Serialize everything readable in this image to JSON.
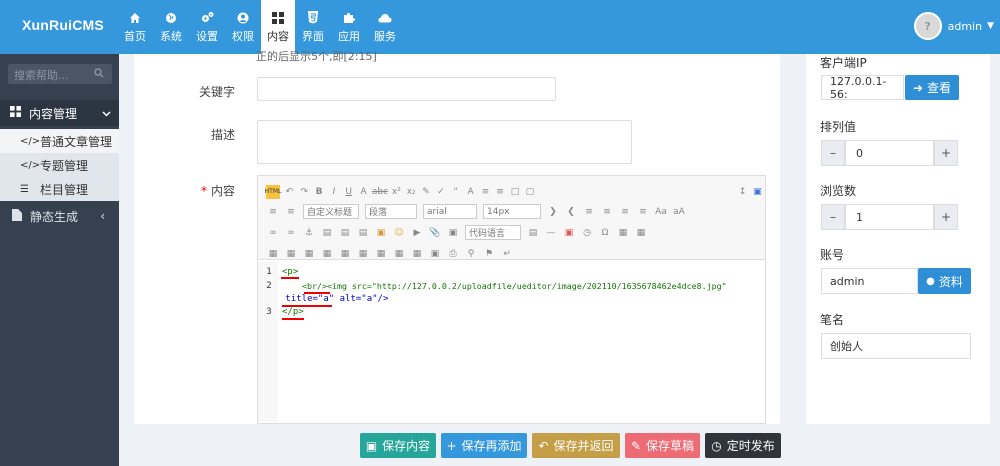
{
  "brand": {
    "logo": "XunRuiCMS"
  },
  "nav": [
    {
      "label": "首页",
      "icon": "home-icon"
    },
    {
      "label": "系统",
      "icon": "globe-icon"
    },
    {
      "label": "设置",
      "icon": "cogs-icon"
    },
    {
      "label": "权限",
      "icon": "user-circle-icon"
    },
    {
      "label": "内容",
      "icon": "grid-icon",
      "active": true
    },
    {
      "label": "界面",
      "icon": "html5-icon"
    },
    {
      "label": "应用",
      "icon": "puzzle-icon"
    },
    {
      "label": "服务",
      "icon": "cloud-icon"
    }
  ],
  "user": {
    "name": "admin"
  },
  "sidebar": {
    "search_placeholder": "搜索帮助...",
    "section": "内容管理",
    "items": [
      {
        "label": "普通文章管理",
        "icon": "code-icon"
      },
      {
        "label": "专题管理",
        "icon": "code-icon"
      },
      {
        "label": "栏目管理",
        "icon": "list-icon"
      }
    ],
    "section2": "静态生成"
  },
  "form": {
    "cut_text": "正的后显示5个,即[2:15]",
    "keywords_label": "关键字",
    "desc_label": "描述",
    "content_label": "内容",
    "required_mark": "*"
  },
  "editor": {
    "style_select": "自定义标题",
    "para_select": "段落",
    "font_select": "arial",
    "size_select": "14px",
    "lang_select": "代码语言",
    "code_lines": [
      {
        "num": "1",
        "text": "<p>"
      },
      {
        "num": "2",
        "text": "    <br/><img src=\"http://127.0.0.2/uploadfile/ueditor/image/202110/1635678462e4dce8.jpg\"",
        "text2": " title=\"a\" alt=\"a\"/>"
      },
      {
        "num": "3",
        "text": "</p>"
      }
    ]
  },
  "right": {
    "ip_label": "客户端IP",
    "ip_value": "127.0.0.1-56:",
    "ip_button": "查看",
    "order_label": "排列值",
    "order_value": "0",
    "views_label": "浏览数",
    "views_value": "1",
    "account_label": "账号",
    "account_value": "admin",
    "account_button": "资料",
    "author_label": "笔名",
    "author_value": "创始人"
  },
  "footer": {
    "save": "保存内容",
    "save_add": "保存再添加",
    "save_back": "保存并返回",
    "save_draft": "保存草稿",
    "schedule": "定时发布"
  },
  "colors": {
    "primary": "#3598dc",
    "green": "#26a69a",
    "blue": "#3598dc",
    "gold": "#c49f47",
    "red": "#ed6b75",
    "dark": "#2f353b"
  }
}
